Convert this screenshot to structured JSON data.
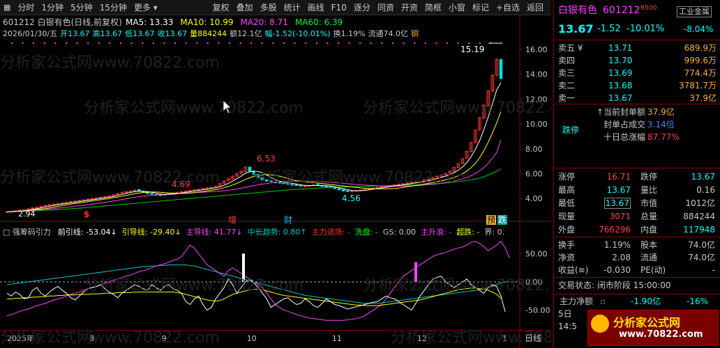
{
  "toolbar": {
    "left_items": [
      "分时",
      "1分钟",
      "5分钟",
      "15分钟",
      "更多"
    ],
    "right_items": [
      "复权",
      "叠加",
      "多股",
      "统计",
      "画线",
      "F10",
      "逐分",
      "同资",
      "开资",
      "简框",
      "小窗",
      "标记",
      "+自选",
      "返回"
    ]
  },
  "chart": {
    "header_line1": "601212 白银有色(日线,前复权)",
    "ma": [
      {
        "label": "MA5: 13.33",
        "color": "#ffffff"
      },
      {
        "label": "MA10: 10.99",
        "color": "#ffff00"
      },
      {
        "label": "MA20: 8.71",
        "color": "#ff40ff"
      },
      {
        "label": "MA60: 6.39",
        "color": "#00ff00"
      }
    ],
    "header_line2": [
      {
        "text": "2026/01/30/五",
        "color": "#c8c8c8"
      },
      {
        "text": "开13.67",
        "color": "#00ffff"
      },
      {
        "text": "高13.67",
        "color": "#00ffff"
      },
      {
        "text": "低13.67",
        "color": "#00ffff"
      },
      {
        "text": "收13.67",
        "color": "#00ffff"
      },
      {
        "text": "量884244",
        "color": "#ffff00"
      },
      {
        "text": "额12.1亿",
        "color": "#c8c8c8"
      },
      {
        "text": "幅-1.52(-10.01%)",
        "color": "#00ffff"
      },
      {
        "text": "换1.19%",
        "color": "#c8c8c8"
      },
      {
        "text": "流通74.0亿",
        "color": "#c8c8c8"
      },
      {
        "text": "铜",
        "color": "#ffb030"
      }
    ],
    "price_labels": {
      "high": "15.19",
      "peak": "6.53",
      "p469": "4.69",
      "low": "4.56",
      "start": "2.94"
    },
    "y_axis": [
      "16.00",
      "14.00",
      "12.00",
      "10.00",
      "8.00",
      "6.00",
      "4.00"
    ],
    "events": {
      "zeng": "增",
      "cai": "财",
      "yu": "预",
      "die": "跌"
    },
    "indicator": {
      "name": "强筹码引力",
      "items": [
        {
          "text": "前引线: -53.04↓",
          "color": "#ffffff"
        },
        {
          "text": "引导线: -29.40↓",
          "color": "#ffff00"
        },
        {
          "text": "主导线: 41.77↓",
          "color": "#ff40ff"
        },
        {
          "text": "中长趋势: 0.80↑",
          "color": "#00c8c8"
        },
        {
          "text": "主力进场: -",
          "color": "#ff3030"
        },
        {
          "text": "洗盘: -",
          "color": "#00ff00"
        },
        {
          "text": "GS: 0.00",
          "color": "#c8c8c8"
        },
        {
          "text": "主升浪: -",
          "color": "#ff40ff"
        },
        {
          "text": "超跌: -",
          "color": "#ffff00"
        },
        {
          "text": "界: 0.",
          "color": "#c8c8c8"
        }
      ],
      "y_axis": [
        "50.00",
        "0.00",
        "-50.00"
      ]
    },
    "x_axis": [
      "2025年",
      "8",
      "9",
      "10",
      "11",
      "12",
      "1"
    ],
    "x_axis_mode": "日线",
    "watermark": "分析家公式网www.70822.com",
    "series": {
      "close": [
        2.94,
        2.96,
        3.0,
        3.05,
        3.1,
        3.18,
        3.25,
        3.3,
        3.38,
        3.45,
        3.5,
        3.55,
        3.6,
        3.65,
        3.7,
        3.75,
        3.8,
        3.85,
        3.9,
        3.95,
        4.0,
        4.05,
        4.1,
        4.15,
        4.2,
        4.3,
        4.4,
        4.5,
        4.55,
        4.6,
        4.69,
        4.6,
        4.5,
        4.4,
        4.35,
        4.3,
        4.28,
        4.32,
        4.4,
        4.45,
        4.5,
        4.55,
        4.6,
        4.65,
        4.7,
        4.75,
        4.8,
        4.85,
        4.9,
        5.0,
        5.2,
        5.4,
        5.6,
        5.8,
        6.0,
        6.2,
        6.53,
        6.2,
        5.9,
        5.7,
        5.5,
        5.4,
        5.35,
        5.3,
        5.25,
        5.2,
        5.15,
        5.1,
        5.05,
        5.0,
        5.0,
        5.05,
        5.1,
        5.05,
        5.0,
        4.95,
        4.9,
        4.8,
        4.7,
        4.6,
        4.56,
        4.6,
        4.65,
        4.7,
        4.75,
        4.8,
        4.85,
        4.9,
        4.95,
        5.0,
        5.05,
        5.1,
        5.15,
        5.2,
        5.25,
        5.3,
        5.35,
        5.4,
        5.5,
        5.6,
        5.7,
        5.8,
        5.9,
        6.0,
        6.2,
        6.5,
        6.8,
        7.2,
        7.8,
        8.5,
        9.5,
        10.5,
        11.5,
        12.65,
        13.9,
        15.19,
        13.67
      ],
      "ma5": [
        2.94,
        2.95,
        2.97,
        2.99,
        3.01,
        3.06,
        3.12,
        3.18,
        3.24,
        3.31,
        3.38,
        3.44,
        3.5,
        3.55,
        3.6,
        3.65,
        3.7,
        3.75,
        3.8,
        3.85,
        3.9,
        3.95,
        4.0,
        4.05,
        4.1,
        4.17,
        4.25,
        4.33,
        4.41,
        4.49,
        4.55,
        4.58,
        4.59,
        4.56,
        4.51,
        4.43,
        4.37,
        4.33,
        4.33,
        4.35,
        4.39,
        4.44,
        4.5,
        4.55,
        4.6,
        4.65,
        4.7,
        4.75,
        4.8,
        4.86,
        4.95,
        5.07,
        5.22,
        5.4,
        5.6,
        5.8,
        6.03,
        6.15,
        6.19,
        6.17,
        6.07,
        5.9,
        5.69,
        5.5,
        5.4,
        5.33,
        5.27,
        5.22,
        5.16,
        5.1,
        5.06,
        5.04,
        5.04,
        5.04,
        5.04,
        5.03,
        5.0,
        4.94,
        4.87,
        4.79,
        4.71,
        4.65,
        4.62,
        4.62,
        4.65,
        4.7,
        4.75,
        4.8,
        4.85,
        4.9,
        4.95,
        5.0,
        5.05,
        5.1,
        5.15,
        5.2,
        5.25,
        5.3,
        5.36,
        5.43,
        5.51,
        5.6,
        5.7,
        5.8,
        5.92,
        6.08,
        6.28,
        6.54,
        6.9,
        7.36,
        7.96,
        8.66,
        9.56,
        10.53,
        11.61,
        12.73,
        13.33
      ],
      "ma10": [
        2.94,
        2.95,
        2.97,
        2.99,
        3.01,
        3.04,
        3.08,
        3.11,
        3.15,
        3.19,
        3.24,
        3.3,
        3.36,
        3.43,
        3.49,
        3.55,
        3.6,
        3.65,
        3.7,
        3.75,
        3.8,
        3.85,
        3.9,
        3.95,
        4.0,
        4.06,
        4.12,
        4.19,
        4.25,
        4.32,
        4.39,
        4.44,
        4.48,
        4.5,
        4.52,
        4.52,
        4.5,
        4.48,
        4.45,
        4.43,
        4.41,
        4.41,
        4.42,
        4.44,
        4.47,
        4.52,
        4.56,
        4.61,
        4.66,
        4.71,
        4.78,
        4.87,
        4.97,
        5.09,
        5.22,
        5.37,
        5.54,
        5.67,
        5.78,
        5.85,
        5.9,
        5.92,
        5.9,
        5.86,
        5.8,
        5.71,
        5.6,
        5.5,
        5.44,
        5.39,
        5.35,
        5.31,
        5.27,
        5.24,
        5.2,
        5.16,
        5.12,
        5.09,
        5.05,
        5.01,
        4.97,
        4.93,
        4.89,
        4.86,
        4.83,
        4.81,
        4.79,
        4.78,
        4.78,
        4.78,
        4.78,
        4.8,
        4.84,
        4.89,
        4.94,
        5.0,
        5.05,
        5.1,
        5.16,
        5.22,
        5.28,
        5.35,
        5.42,
        5.5,
        5.59,
        5.7,
        5.83,
        6.0,
        6.21,
        6.49,
        6.84,
        7.29,
        7.86,
        8.52,
        9.27,
        10.08,
        10.99
      ],
      "ma20": [
        2.94,
        2.95,
        2.96,
        2.98,
        3.0,
        3.02,
        3.04,
        3.07,
        3.1,
        3.13,
        3.16,
        3.19,
        3.23,
        3.26,
        3.3,
        3.34,
        3.38,
        3.42,
        3.46,
        3.5,
        3.55,
        3.6,
        3.65,
        3.7,
        3.75,
        3.8,
        3.86,
        3.92,
        3.98,
        4.04,
        4.1,
        4.15,
        4.19,
        4.22,
        4.26,
        4.29,
        4.32,
        4.34,
        4.36,
        4.38,
        4.4,
        4.42,
        4.44,
        4.46,
        4.48,
        4.5,
        4.51,
        4.53,
        4.55,
        4.57,
        4.6,
        4.63,
        4.67,
        4.72,
        4.77,
        4.83,
        4.9,
        4.97,
        5.04,
        5.1,
        5.16,
        5.21,
        5.26,
        5.3,
        5.34,
        5.37,
        5.39,
        5.4,
        5.41,
        5.41,
        5.4,
        5.39,
        5.38,
        5.37,
        5.35,
        5.33,
        5.31,
        5.28,
        5.25,
        5.22,
        5.19,
        5.16,
        5.13,
        5.1,
        5.08,
        5.06,
        5.04,
        5.02,
        5.01,
        5.0,
        4.99,
        4.99,
        4.99,
        5.0,
        5.01,
        5.02,
        5.04,
        5.06,
        5.08,
        5.11,
        5.14,
        5.18,
        5.22,
        5.27,
        5.33,
        5.4,
        5.48,
        5.58,
        5.7,
        5.84,
        6.02,
        6.23,
        6.5,
        6.83,
        7.23,
        7.7,
        8.71
      ],
      "ma60": [
        2.94,
        2.95,
        2.96,
        2.97,
        2.98,
        2.99,
        3.0,
        3.01,
        3.03,
        3.05,
        3.07,
        3.09,
        3.11,
        3.13,
        3.15,
        3.17,
        3.2,
        3.22,
        3.25,
        3.28,
        3.31,
        3.34,
        3.37,
        3.4,
        3.43,
        3.46,
        3.49,
        3.52,
        3.55,
        3.58,
        3.61,
        3.64,
        3.67,
        3.7,
        3.73,
        3.76,
        3.79,
        3.82,
        3.85,
        3.88,
        3.91,
        3.94,
        3.97,
        4.0,
        4.03,
        4.06,
        4.09,
        4.12,
        4.15,
        4.18,
        4.21,
        4.24,
        4.27,
        4.3,
        4.33,
        4.36,
        4.39,
        4.42,
        4.45,
        4.48,
        4.51,
        4.54,
        4.57,
        4.6,
        4.63,
        4.66,
        4.69,
        4.72,
        4.74,
        4.76,
        4.78,
        4.8,
        4.82,
        4.84,
        4.86,
        4.88,
        4.9,
        4.91,
        4.92,
        4.93,
        4.94,
        4.95,
        4.96,
        4.97,
        4.98,
        4.99,
        5.0,
        5.01,
        5.02,
        5.03,
        5.04,
        5.05,
        5.06,
        5.07,
        5.08,
        5.09,
        5.1,
        5.12,
        5.14,
        5.16,
        5.18,
        5.2,
        5.22,
        5.25,
        5.28,
        5.31,
        5.35,
        5.4,
        5.45,
        5.5,
        5.57,
        5.65,
        5.75,
        5.88,
        6.03,
        6.2,
        6.39
      ],
      "ind_white": [
        -20,
        -25,
        -18,
        -22,
        -30,
        -28,
        -15,
        -10,
        -20,
        -25,
        -18,
        -12,
        -8,
        -15,
        -20,
        -28,
        -32,
        -25,
        -18,
        -12,
        -10,
        -8,
        -5,
        -12,
        -18,
        -22,
        -28,
        -20,
        -15,
        -10,
        -5,
        -8,
        -12,
        -15,
        -5,
        -10,
        -15,
        -8,
        -5,
        -12,
        -15,
        -20,
        -35,
        -40,
        -30,
        -25,
        -40,
        -50,
        -45,
        -30,
        -20,
        -10,
        5,
        -5,
        -20,
        -10,
        0,
        5,
        -2,
        -10,
        -20,
        -30,
        -45,
        -40,
        -35,
        -30,
        -28,
        -35,
        -40,
        -38,
        -30,
        -35,
        -42,
        -45,
        -38,
        -30,
        -35,
        -40,
        -42,
        -45,
        -48,
        -46,
        -44,
        -42,
        -40,
        -38,
        -36,
        -35,
        -30,
        -25,
        -28,
        -30,
        -35,
        -40,
        -45,
        -50,
        -38,
        -25,
        -15,
        -5,
        5,
        8,
        10,
        0,
        -5,
        -10,
        -5,
        0,
        5,
        -5,
        -10,
        -15,
        -20,
        -10,
        -5,
        -8,
        -25,
        -53
      ],
      "ind_yellow": [
        -30,
        -30,
        -29,
        -29,
        -28,
        -28,
        -27,
        -27,
        -26,
        -26,
        -25,
        -25,
        -24,
        -24,
        -23,
        -23,
        -23,
        -22,
        -22,
        -22,
        -21,
        -21,
        -21,
        -20,
        -20,
        -20,
        -19,
        -19,
        -19,
        -19,
        -18,
        -18,
        -18,
        -18,
        -18,
        -18,
        -18,
        -18,
        -18,
        -18,
        -19,
        -20,
        -22,
        -24,
        -26,
        -28,
        -30,
        -32,
        -33,
        -34,
        -33,
        -30,
        -26,
        -22,
        -20,
        -18,
        -16,
        -14,
        -13,
        -13,
        -14,
        -16,
        -18,
        -20,
        -22,
        -24,
        -25,
        -26,
        -27,
        -28,
        -29,
        -30,
        -31,
        -32,
        -33,
        -34,
        -35,
        -36,
        -37,
        -38,
        -39,
        -40,
        -41,
        -41,
        -42,
        -42,
        -42,
        -42,
        -41,
        -40,
        -39,
        -38,
        -37,
        -36,
        -35,
        -34,
        -33,
        -32,
        -30,
        -28,
        -26,
        -24,
        -22,
        -20,
        -18,
        -16,
        -14,
        -13,
        -12,
        -11,
        -11,
        -12,
        -13,
        -15,
        -18,
        -22,
        -29
      ],
      "ind_magenta": [
        -60,
        -58,
        -55,
        -52,
        -50,
        -48,
        -45,
        -42,
        -40,
        -38,
        -35,
        -32,
        -30,
        -28,
        -25,
        -22,
        -20,
        -18,
        -15,
        -12,
        -10,
        -8,
        -5,
        -2,
        0,
        3,
        5,
        8,
        10,
        12,
        15,
        18,
        20,
        22,
        25,
        28,
        30,
        32,
        35,
        38,
        40,
        45,
        55,
        65,
        60,
        50,
        40,
        30,
        25,
        20,
        15,
        10,
        20,
        25,
        20,
        15,
        10,
        5,
        0,
        -5,
        -10,
        -20,
        -30,
        -40,
        -45,
        -50,
        -52,
        -55,
        -58,
        -60,
        -62,
        -64,
        -65,
        -66,
        -67,
        -68,
        -68,
        -68,
        -68,
        -68,
        -67,
        -66,
        -65,
        -63,
        -60,
        -55,
        -50,
        -45,
        -40,
        -30,
        -20,
        -10,
        0,
        10,
        15,
        20,
        25,
        30,
        35,
        40,
        45,
        48,
        50,
        52,
        55,
        58,
        60,
        62,
        65,
        70,
        72,
        68,
        62,
        55,
        60,
        65,
        72,
        60,
        42
      ],
      "ind_cyan": [
        -5,
        -4,
        -3,
        -2,
        -1,
        0,
        1,
        2,
        3,
        4,
        5,
        6,
        7,
        8,
        9,
        10,
        11,
        12,
        13,
        14,
        15,
        16,
        17,
        18,
        19,
        20,
        21,
        22,
        23,
        24,
        25,
        26,
        27,
        27,
        28,
        28,
        29,
        29,
        30,
        30,
        30,
        30,
        30,
        29,
        28,
        26,
        24,
        22,
        20,
        18,
        16,
        14,
        12,
        10,
        8,
        6,
        4,
        2,
        0,
        -2,
        -4,
        -6,
        -8,
        -10,
        -12,
        -14,
        -16,
        -18,
        -20,
        -22,
        -24,
        -25,
        -26,
        -27,
        -28,
        -29,
        -30,
        -31,
        -32,
        -33,
        -34,
        -35,
        -36,
        -37,
        -38,
        -38,
        -38,
        -38,
        -37,
        -36,
        -35,
        -34,
        -33,
        -32,
        -31,
        -30,
        -29,
        -28,
        -27,
        -26,
        -25,
        -24,
        -23,
        -22,
        -21,
        -20,
        -19,
        -18,
        -17,
        -16,
        -15,
        -14,
        -12,
        -10,
        -8,
        -5,
        -2,
        0,
        1
      ]
    }
  },
  "quote": {
    "name": "白银有色",
    "code": "601212",
    "badge": "R500",
    "sector": "工业金属",
    "price": "13.67",
    "change": "-1.52",
    "change_pct": "-10.01%",
    "sector_pct": "-8.04%",
    "asks": [
      {
        "label": "卖五 ¥",
        "price": "13.71",
        "vol": "689.9万"
      },
      {
        "label": "卖四",
        "price": "13.70",
        "vol": "999.6万"
      },
      {
        "label": "卖三",
        "price": "13.69",
        "vol": "774.4万"
      },
      {
        "label": "卖二",
        "price": "13.68",
        "vol": "3781.7万"
      },
      {
        "label": "卖一",
        "price": "13.67",
        "vol": "37.9亿"
      }
    ],
    "limit_status": "跌停",
    "limit_info": [
      {
        "label": "↑当前封单额",
        "value": "37.9亿"
      },
      {
        "label": "封单占成交",
        "value": "3.14倍"
      },
      {
        "label": "十日总涨幅",
        "value": "87.77%"
      }
    ],
    "stats": [
      {
        "l1": "涨停",
        "v1": "16.71",
        "c1": "#ff4040",
        "l2": "跌停",
        "v2": "13.67",
        "c2": "#00ffff"
      },
      {
        "l1": "最高",
        "v1": "13.67",
        "c1": "#00ffff",
        "l2": "量比",
        "v2": "0.16",
        "c2": "#c8c8c8"
      },
      {
        "l1": "最低",
        "v1": "13.67",
        "c1": "#00ffff",
        "l2": "市值",
        "v2": "1012亿",
        "c2": "#c8c8c8"
      },
      {
        "l1": "现量",
        "v1": "3071",
        "c1": "#ff4040",
        "l2": "总量",
        "v2": "884244",
        "c2": "#c8c8c8"
      },
      {
        "l1": "外盘",
        "v1": "766296",
        "c1": "#ff4040",
        "l2": "内盘",
        "v2": "117948",
        "c2": "#00ffff"
      }
    ],
    "stats2": [
      {
        "l1": "换手",
        "v1": "1.19%",
        "l2": "股本",
        "v2": "74.0亿"
      },
      {
        "l1": "净资",
        "v1": "2.08",
        "l2": "流通",
        "v2": "74.0亿"
      },
      {
        "l1": "收益(≡)",
        "v1": "-0.030",
        "l2": "PE(动)",
        "v2": "-"
      }
    ],
    "trade_state": "交易状态: 闭市阶段 15:00:00",
    "net_label": "主力净额",
    "net_value": "-1.90亿",
    "net_pct": "-16%",
    "day_label": "5日",
    "time_partial": "14:5",
    "logo_text": "分析家公式网",
    "logo_url": "www.70822.com"
  }
}
